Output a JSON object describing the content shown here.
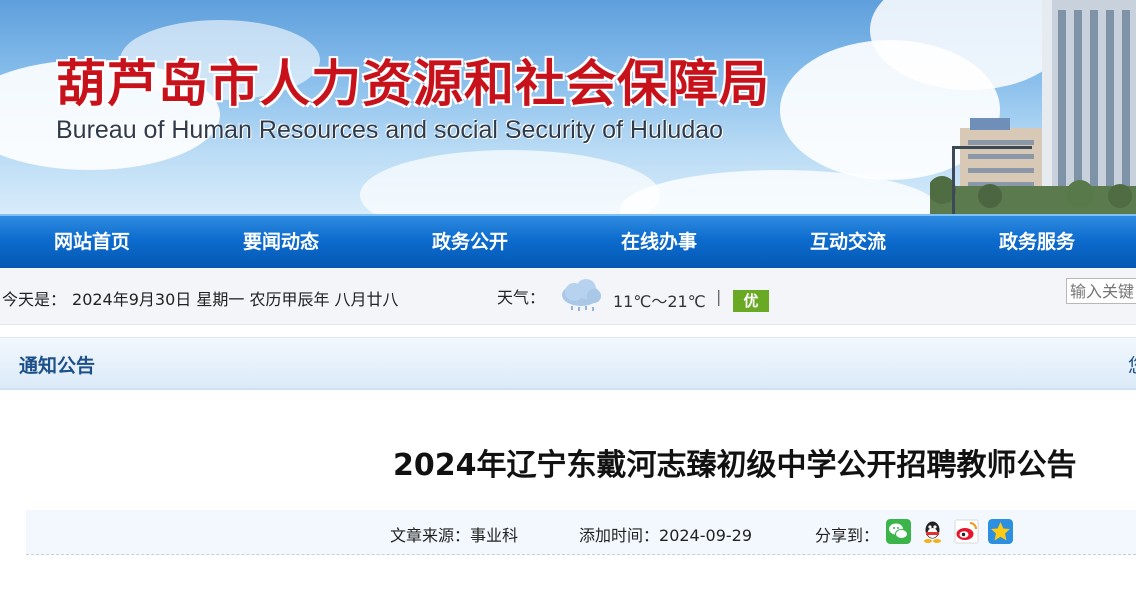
{
  "header": {
    "title_cn": "葫芦岛市人力资源和社会保障局",
    "title_en": "Bureau of Human Resources and social Security of Huludao"
  },
  "nav": {
    "items": [
      {
        "label": "网站首页"
      },
      {
        "label": "要闻动态"
      },
      {
        "label": "政务公开"
      },
      {
        "label": "在线办事"
      },
      {
        "label": "互动交流"
      },
      {
        "label": "政务服务"
      }
    ]
  },
  "infobar": {
    "today_label": "今天是：",
    "date_text": "2024年9月30日 星期一 农历甲辰年 八月廿八",
    "weather_label": "天气：",
    "weather_icon": "cloud-rain-icon",
    "temperature": "11℃～21℃",
    "separator": "|",
    "air_quality": "优",
    "air_quality_color": "#6aa923",
    "search_placeholder": "输入关键"
  },
  "section": {
    "title": "通知公告",
    "right_text": "您"
  },
  "article": {
    "title": "2024年辽宁东戴河志臻初级中学公开招聘教师公告",
    "source_label": "文章来源：",
    "source": "事业科",
    "time_label": "添加时间：",
    "time": "2024-09-29",
    "share_label": "分享到：",
    "share_icons": [
      "wechat-icon",
      "qq-icon",
      "weibo-icon",
      "qzone-icon"
    ]
  },
  "colors": {
    "nav_blue": "#0d6cce",
    "title_red": "#c8121b",
    "section_text": "#1d4f88"
  }
}
